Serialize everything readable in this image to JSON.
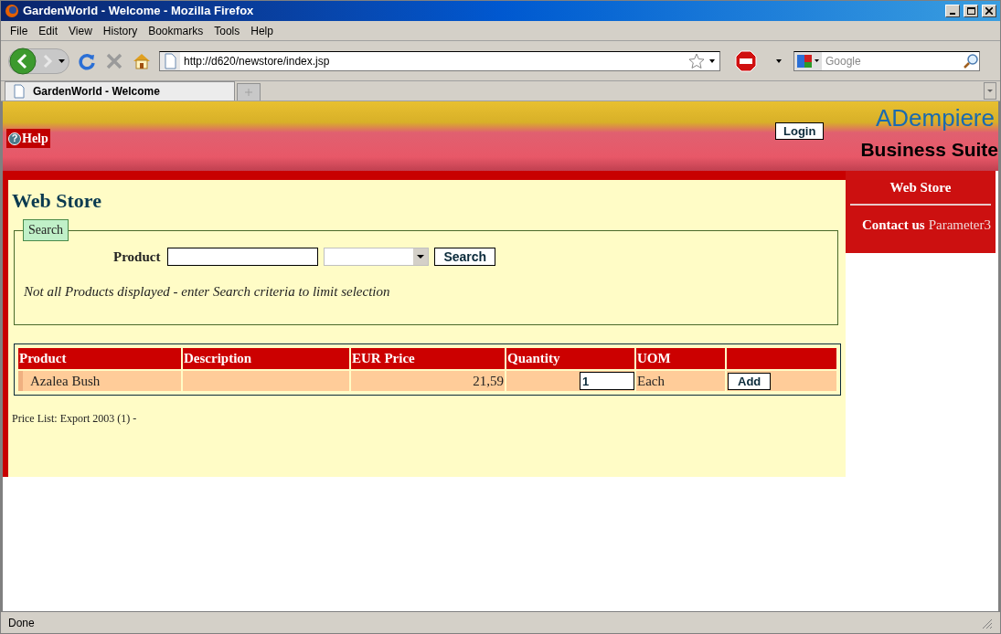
{
  "window": {
    "title": "GardenWorld - Welcome - Mozilla Firefox"
  },
  "menu": [
    "File",
    "Edit",
    "View",
    "History",
    "Bookmarks",
    "Tools",
    "Help"
  ],
  "nav": {
    "url": "http://d620/newstore/index.jsp",
    "search_placeholder": "Google"
  },
  "tabs": [
    {
      "label": "GardenWorld - Welcome",
      "selected": true
    }
  ],
  "banner": {
    "help_icon": "?",
    "help": "Help",
    "login": "Login",
    "logo": "ADempiere",
    "logo_tagline": "Business Suite"
  },
  "store": {
    "title": "Web Store",
    "search": {
      "legend": "Search",
      "product_label": "Product",
      "button": "Search",
      "notice": "Not all Products displayed - enter Search criteria to limit selection"
    },
    "table": {
      "columns": [
        "Product",
        "Description",
        "EUR Price",
        "Quantity",
        "UOM"
      ],
      "rows": [
        {
          "product": "Azalea Bush",
          "description": "",
          "price": "21,59",
          "quantity": "1",
          "uom": "Each",
          "action": "Add"
        }
      ]
    },
    "price_list": "Price List: Export 2003 (1) -"
  },
  "sidebar": {
    "title": "Web Store",
    "contact_label": "Contact us",
    "contact_value": "Parameter3"
  },
  "status_bar": {
    "text": "Done"
  }
}
